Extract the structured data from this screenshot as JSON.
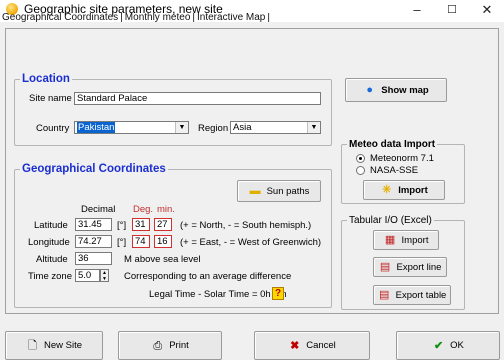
{
  "window": {
    "title": "Geographic site parameters, new site",
    "minimize": "–",
    "maximize": "☐",
    "close": "✕"
  },
  "tabs": [
    "Geographical Coordinates",
    "Monthly meteo",
    "Interactive Map"
  ],
  "location": {
    "group_title": "Location",
    "site_name_label": "Site name",
    "site_name_value": "Standard Palace",
    "country_label": "Country",
    "country_value": "Pakistan",
    "region_label": "Region",
    "region_value": "Asia",
    "show_map_label": "Show map"
  },
  "geo": {
    "group_title": "Geographical Coordinates",
    "sun_paths_label": "Sun paths",
    "decimal_header": "Decimal",
    "deg_header": "Deg.",
    "min_header": "min.",
    "latitude_label": "Latitude",
    "latitude_decimal": "31.45",
    "latitude_unit": "[°]",
    "latitude_deg": "31",
    "latitude_min": "27",
    "latitude_hint": "(+ = North,  - = South hemisph.)",
    "longitude_label": "Longitude",
    "longitude_decimal": "74.27",
    "longitude_unit": "[°]",
    "longitude_deg": "74",
    "longitude_min": "16",
    "longitude_hint": "(+ = East,  - = West of Greenwich)",
    "altitude_label": "Altitude",
    "altitude_value": "36",
    "altitude_hint": "M above sea level",
    "timezone_label": "Time zone",
    "timezone_value": "5.0",
    "timezone_hint": "Corresponding to an average difference",
    "legal_time_text": "Legal Time - Solar Time =  0h  3m",
    "help_label": "?"
  },
  "meteo_import": {
    "group_title": "Meteo data Import",
    "options": [
      "Meteonorm 7.1",
      "NASA-SSE"
    ],
    "selected": "Meteonorm 7.1",
    "import_label": "Import"
  },
  "tabular": {
    "group_title": "Tabular I/O (Excel)",
    "import_label": "Import",
    "export_line_label": "Export line",
    "export_table_label": "Export table"
  },
  "footer": {
    "new_site": "New Site",
    "print": "Print",
    "cancel": "Cancel",
    "ok": "OK"
  }
}
